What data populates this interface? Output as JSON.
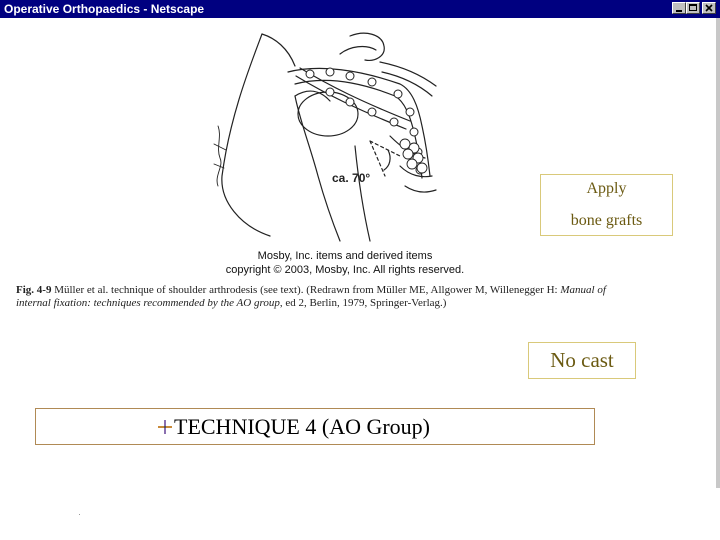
{
  "window": {
    "title": "Operative Orthopaedics - Netscape",
    "controls": [
      "minimize-icon",
      "maximize-icon",
      "close-icon"
    ],
    "titlebar_color": "#000080"
  },
  "figure": {
    "angle_label": "ca. 70°",
    "credit_line1": "Mosby, Inc. items and derived items",
    "credit_line2": "copyright © 2003, Mosby, Inc. All rights reserved.",
    "caption": {
      "label": "Fig. 4-9",
      "line1_text": " Müller et al. technique of shoulder arthrodesis (see text). (Redrawn from Müller ME, Allgower M, Willenegger H: ",
      "line1_book": "Manual of",
      "line2_book": "internal fixation: techniques recommended by the AO group",
      "line2_text": ", ed 2, Berlin, 1979, Springer-Verlag.)"
    }
  },
  "callouts": {
    "grafts_line1": "Apply",
    "grafts_line2": "bone grafts",
    "no_cast": "No cast"
  },
  "technique": {
    "title": "TECHNIQUE 4 (AO Group)"
  },
  "colors": {
    "callout_text": "#6b5a12",
    "callout_border": "#d9c97a",
    "technique_border": "#b08a55"
  }
}
